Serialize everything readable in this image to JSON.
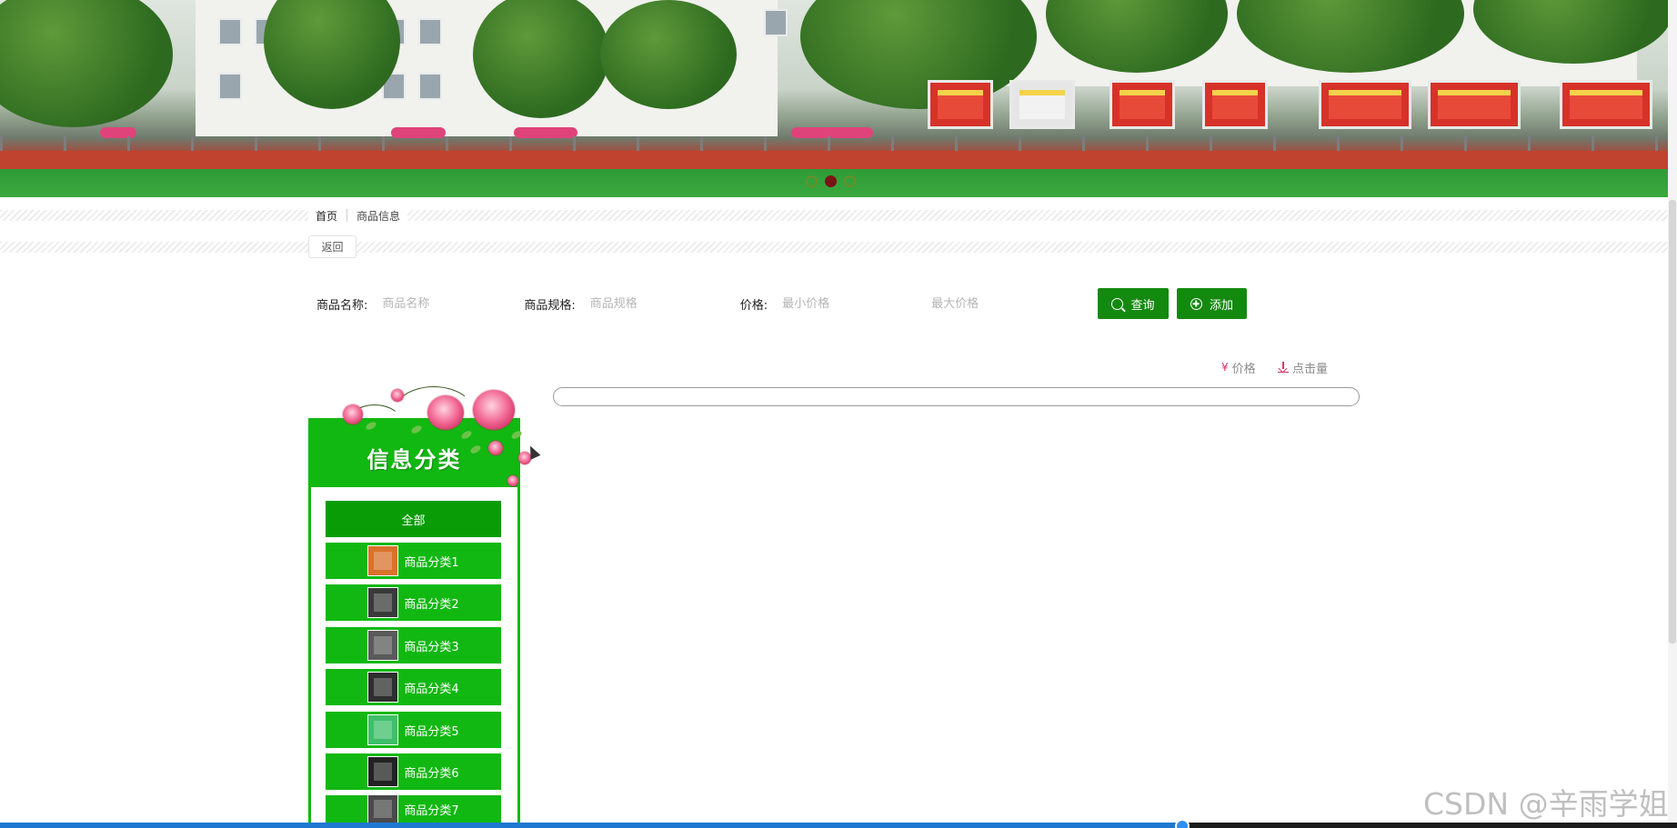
{
  "banner": {
    "dots": [
      {
        "active": false
      },
      {
        "active": true
      },
      {
        "active": false
      }
    ]
  },
  "breadcrumb": {
    "home": "首页",
    "current": "商品信息"
  },
  "back_label": "返回",
  "search": {
    "name_label": "商品名称:",
    "name_placeholder": "商品名称",
    "spec_label": "商品规格:",
    "spec_placeholder": "商品规格",
    "price_label": "价格:",
    "min_price_placeholder": "最小价格",
    "max_price_placeholder": "最大价格",
    "query_label": "查询",
    "add_label": "添加"
  },
  "sort": {
    "price_label": "价格",
    "clicks_label": "点击量"
  },
  "categories": {
    "title": "信息分类",
    "all_label": "全部",
    "items": [
      {
        "label": "商品分类1",
        "color": "#d9722c"
      },
      {
        "label": "商品分类2",
        "color": "#3a3a3a"
      },
      {
        "label": "商品分类3",
        "color": "#5a5a5a"
      },
      {
        "label": "商品分类4",
        "color": "#2e2e2e"
      },
      {
        "label": "商品分类5",
        "color": "#3fbf6a"
      },
      {
        "label": "商品分类6",
        "color": "#222222"
      },
      {
        "label": "商品分类7",
        "color": "#4a4a4a"
      }
    ]
  },
  "watermark": "CSDN @辛雨学姐",
  "colors": {
    "accent_green": "#11b811",
    "button_green": "#138a0f",
    "sort_icon": "#d6336c"
  }
}
